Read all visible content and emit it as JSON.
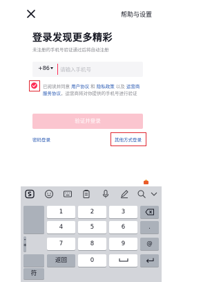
{
  "header": {
    "close_icon": "close-icon",
    "help_label": "帮助与设置"
  },
  "login": {
    "title": "登录发现更多精彩",
    "subtitle": "未注册的手机号验证通过后将自动注册",
    "country_code": "+86",
    "phone_placeholder": "请输入手机号",
    "phone_value": "",
    "agree_prefix": "已阅读并同意 ",
    "agree_user_agreement": "用户协议",
    "agree_and": " 和 ",
    "agree_privacy": "隐私政策",
    "agree_mid": " 以及 ",
    "agree_operator": "运营商服务协议",
    "agree_suffix": "，运营商将对你提供的手机号进行验证",
    "agree_checked": true,
    "submit_label": "验证并登录",
    "password_login_label": "密码登录",
    "other_login_label": "其他方式登录"
  },
  "keyboard": {
    "toolbar_icons": [
      "sogou-logo-icon",
      "emoji-icon",
      "keyboard-icon",
      "clipboard-icon",
      "microphone-icon",
      "handwriting-icon",
      "search-icon",
      "collapse-keyboard-icon"
    ],
    "side_keys": [
      "+",
      "·",
      "*",
      "#"
    ],
    "side_extra": "-",
    "row1": [
      "1",
      "2",
      "3"
    ],
    "row2": [
      "4",
      "5",
      "6"
    ],
    "row3": [
      "7",
      "8",
      "9"
    ],
    "row4": [
      "符",
      "返回",
      "0"
    ],
    "right_keys": [
      "backspace-icon",
      ".",
      "@"
    ],
    "space_icon": "space-icon",
    "enter_icon": "enter-icon"
  },
  "colors": {
    "accent": "#fe2c55",
    "link": "#2a5ab3",
    "disabled_button": "#fbc5cf",
    "highlight_box": "#e0262f"
  }
}
